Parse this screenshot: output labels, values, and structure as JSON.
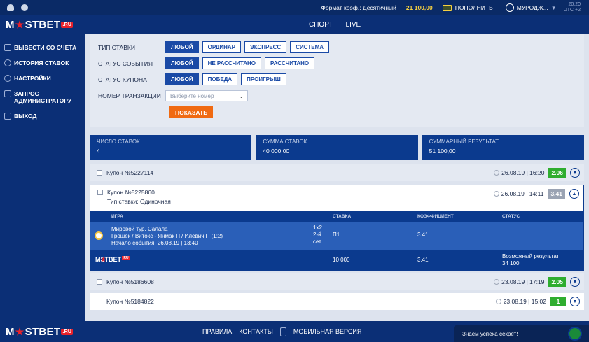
{
  "topbar": {
    "odds_format": "Формат коэф.: Десятичный",
    "balance": "21 100,00",
    "deposit_label": "ПОПОЛНИТЬ",
    "user_label": "МУРОДЖ...",
    "time": "20:20",
    "timezone": "UTC +2"
  },
  "header": {
    "logo": {
      "prefix": "M",
      "suffix": "STBET",
      "domain": ".RU"
    },
    "nav": [
      "СПОРТ",
      "LIVE"
    ]
  },
  "sidebar": {
    "items": [
      {
        "label": "ВЫВЕСТИ СО СЧЕТА",
        "icon": "withdraw-icon"
      },
      {
        "label": "ИСТОРИЯ СТАВОК",
        "icon": "history-icon"
      },
      {
        "label": "НАСТРОЙКИ",
        "icon": "settings-icon"
      },
      {
        "label": "ЗАПРОС АДМИНИСТРАТОРУ",
        "icon": "chat-icon"
      },
      {
        "label": "ВЫХОД",
        "icon": "logout-icon"
      }
    ]
  },
  "filters": {
    "bet_type": {
      "label": "ТИП СТАВКИ",
      "options": [
        "ЛЮБОЙ",
        "ОРДИНАР",
        "ЭКСПРЕСС",
        "СИСТЕМА"
      ],
      "active": 0
    },
    "event_status": {
      "label": "СТАТУС СОБЫТИЯ",
      "options": [
        "ЛЮБОЙ",
        "НЕ РАССЧИТАНО",
        "РАССЧИТАНО"
      ],
      "active": 0
    },
    "coupon_status": {
      "label": "СТАТУС КУПОНА",
      "options": [
        "ЛЮБОЙ",
        "ПОБЕДА",
        "ПРОИГРЫШ"
      ],
      "active": 0
    },
    "transaction": {
      "label": "НОМЕР ТРАНЗАКЦИИ",
      "placeholder": "Выберите номер"
    },
    "show_button": "ПОКАЗАТЬ"
  },
  "stats": [
    {
      "label": "ЧИСЛО СТАВОК",
      "value": "4"
    },
    {
      "label": "СУММА СТАВОК",
      "value": "40 000,00"
    },
    {
      "label": "СУММАРНЫЙ РЕЗУЛЬТАТ",
      "value": "51 100,00"
    }
  ],
  "coupons": [
    {
      "title": "Купон №5227114",
      "date": "26.08.19 | 16:20",
      "result": "2.06",
      "status": "win"
    },
    {
      "title": "Купон №5225860",
      "date": "26.08.19 | 14:11",
      "result": "3.41",
      "status": "grey",
      "bet_type": "Тип ставки: Одиночная"
    },
    {
      "title": "Купон №5186608",
      "date": "23.08.19 | 17:19",
      "result": "2.05",
      "status": "win"
    },
    {
      "title": "Купон №5184822",
      "date": "23.08.19 | 15:02",
      "result": "1",
      "status": "win"
    }
  ],
  "details": {
    "headers": {
      "game": "ИГРА",
      "bet": "СТАВКА",
      "coef": "КОЭФФИЦИЕНТ",
      "status": "СТАТУС"
    },
    "row": {
      "tournament": "Мировой тур. Салала",
      "match": "Грошек / Витокс - Янмак П / Илевич П (1:2)",
      "start": "Начало события: 26.08.19 | 13:40",
      "market_line1": "1х2.",
      "market_line2": "2-й",
      "market_line3": "сет",
      "bet": "П1",
      "coef": "3.41"
    },
    "footer": {
      "stake": "10 000",
      "coef": "3.41",
      "possible_label": "Возможный результат",
      "possible_value": "34 100"
    }
  },
  "footer": {
    "links": [
      "ПРАВИЛА",
      "КОНТАКТЫ",
      "МОБИЛЬНАЯ ВЕРСИЯ"
    ],
    "chat_text": "Знаем успеха секрет!"
  }
}
